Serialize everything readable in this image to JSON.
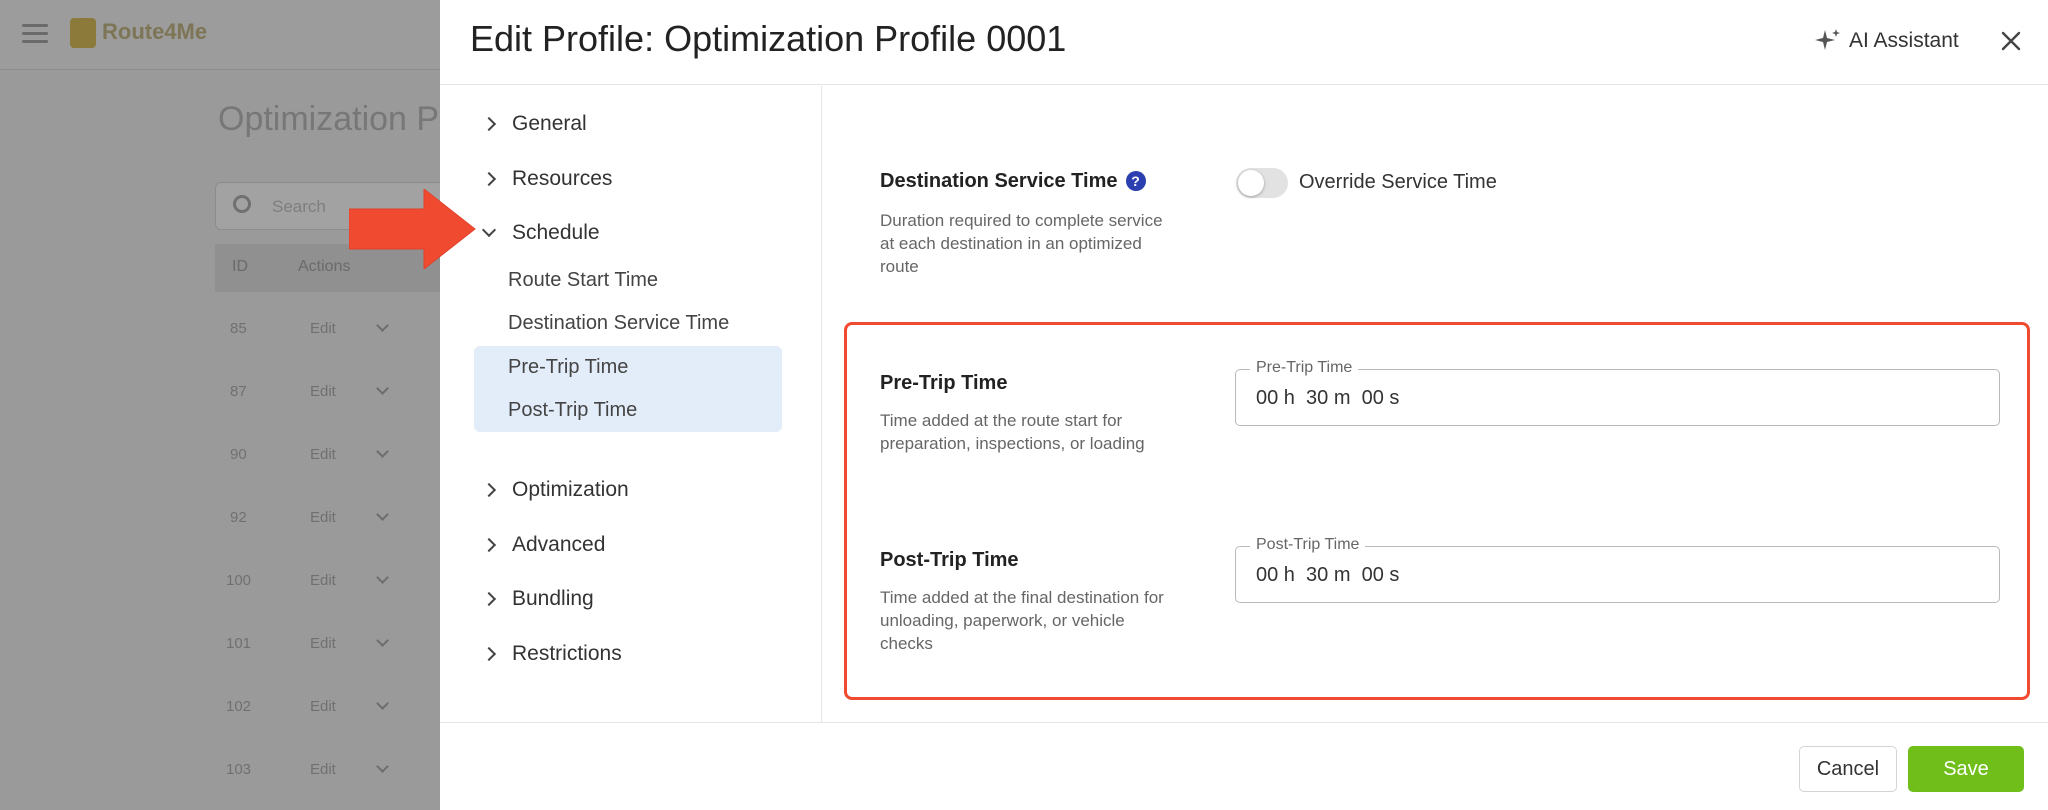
{
  "background": {
    "logo": "Route4Me",
    "page_title": "Optimization P",
    "search_placeholder": "Search",
    "columns": [
      "ID",
      "Actions"
    ],
    "rows": [
      {
        "id": "85",
        "action": "Edit"
      },
      {
        "id": "87",
        "action": "Edit"
      },
      {
        "id": "90",
        "action": "Edit"
      },
      {
        "id": "92",
        "action": "Edit"
      },
      {
        "id": "100",
        "action": "Edit"
      },
      {
        "id": "101",
        "action": "Edit"
      },
      {
        "id": "102",
        "action": "Edit"
      },
      {
        "id": "103",
        "action": "Edit"
      }
    ]
  },
  "modal": {
    "title": "Edit Profile: Optimization Profile 0001",
    "ai_assistant_label": "AI Assistant",
    "close_icon": "close-icon"
  },
  "sidebar": {
    "sections": [
      {
        "label": "General",
        "expanded": false
      },
      {
        "label": "Resources",
        "expanded": false
      },
      {
        "label": "Schedule",
        "expanded": true
      },
      {
        "label": "Optimization",
        "expanded": false
      },
      {
        "label": "Advanced",
        "expanded": false
      },
      {
        "label": "Bundling",
        "expanded": false
      },
      {
        "label": "Restrictions",
        "expanded": false
      }
    ],
    "schedule_items": [
      {
        "label": "Route Start Time",
        "active": false
      },
      {
        "label": "Destination Service Time",
        "active": false
      },
      {
        "label": "Pre-Trip Time",
        "active": true
      },
      {
        "label": "Post-Trip Time",
        "active": true
      }
    ]
  },
  "content": {
    "destination_service": {
      "title": "Destination Service Time",
      "help": "?",
      "description": "Duration required to complete service at each destination in an optimized route",
      "toggle_label": "Override Service Time",
      "toggle_on": false
    },
    "pre_trip": {
      "title": "Pre-Trip Time",
      "description": "Time added at the route start for preparation, inspections, or loading",
      "field_label": "Pre-Trip Time",
      "value": "00 h  30 m  00 s"
    },
    "post_trip": {
      "title": "Post-Trip Time",
      "description": "Time added at the final destination for unloading, paperwork, or vehicle checks",
      "field_label": "Post-Trip Time",
      "value": "00 h  30 m  00 s"
    }
  },
  "footer": {
    "cancel_label": "Cancel",
    "save_label": "Save"
  },
  "colors": {
    "accent_save": "#6fbe1a",
    "highlight": "#f04a30",
    "active_nav": "#e3edf9",
    "help_icon": "#2b3fb0"
  }
}
